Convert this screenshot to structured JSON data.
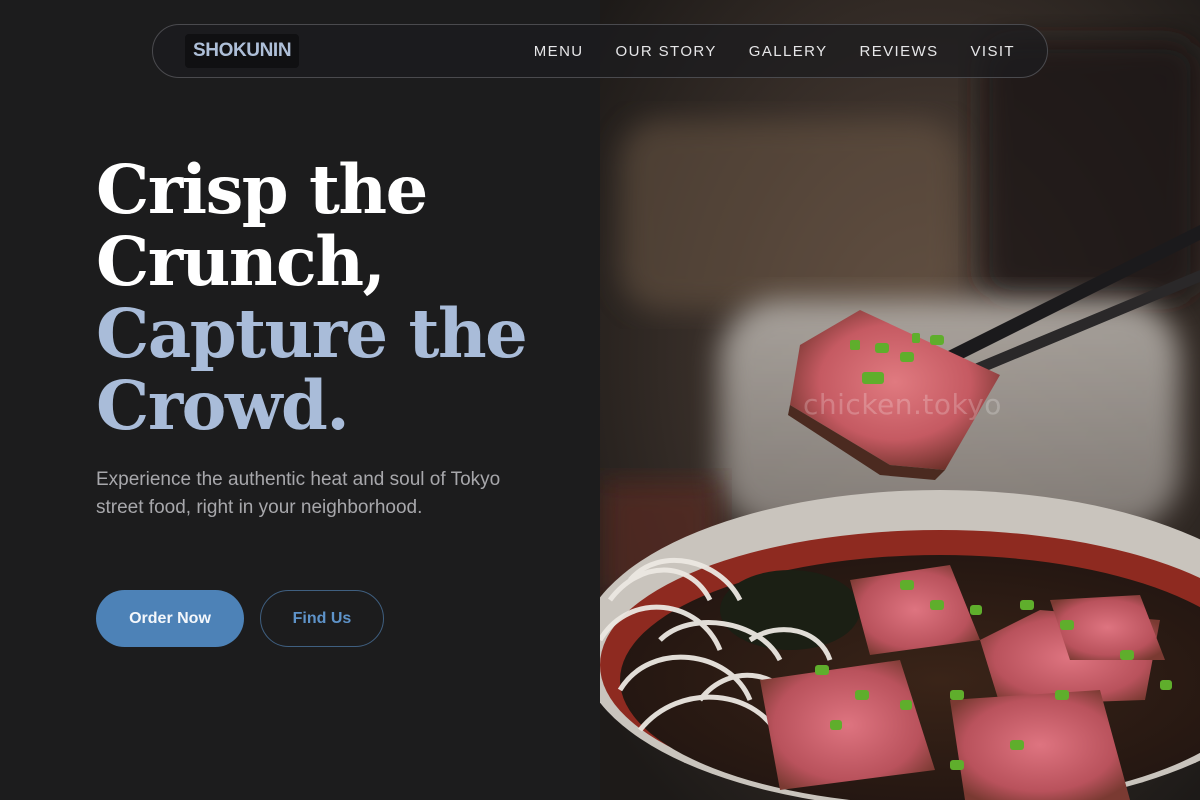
{
  "brand": {
    "logo_text": "SHOKUNIN"
  },
  "nav": {
    "links": [
      "MENU",
      "OUR STORY",
      "GALLERY",
      "REVIEWS",
      "VISIT"
    ]
  },
  "hero": {
    "headline_lines": [
      "Crisp the",
      "Crunch,",
      "Capture the",
      "Crowd."
    ],
    "subtitle": "Experience the authentic heat and soul of Tokyo street food, right in your neighborhood.",
    "primary_button": "Order Now",
    "secondary_button": "Find Us"
  },
  "photo": {
    "watermark": "chicken.tokyo"
  },
  "colors": {
    "background": "#1c1c1d",
    "accent_blue": "#4d82b7",
    "headline_blue": "#a9bcd9",
    "logo_text": "#aebfd8"
  }
}
